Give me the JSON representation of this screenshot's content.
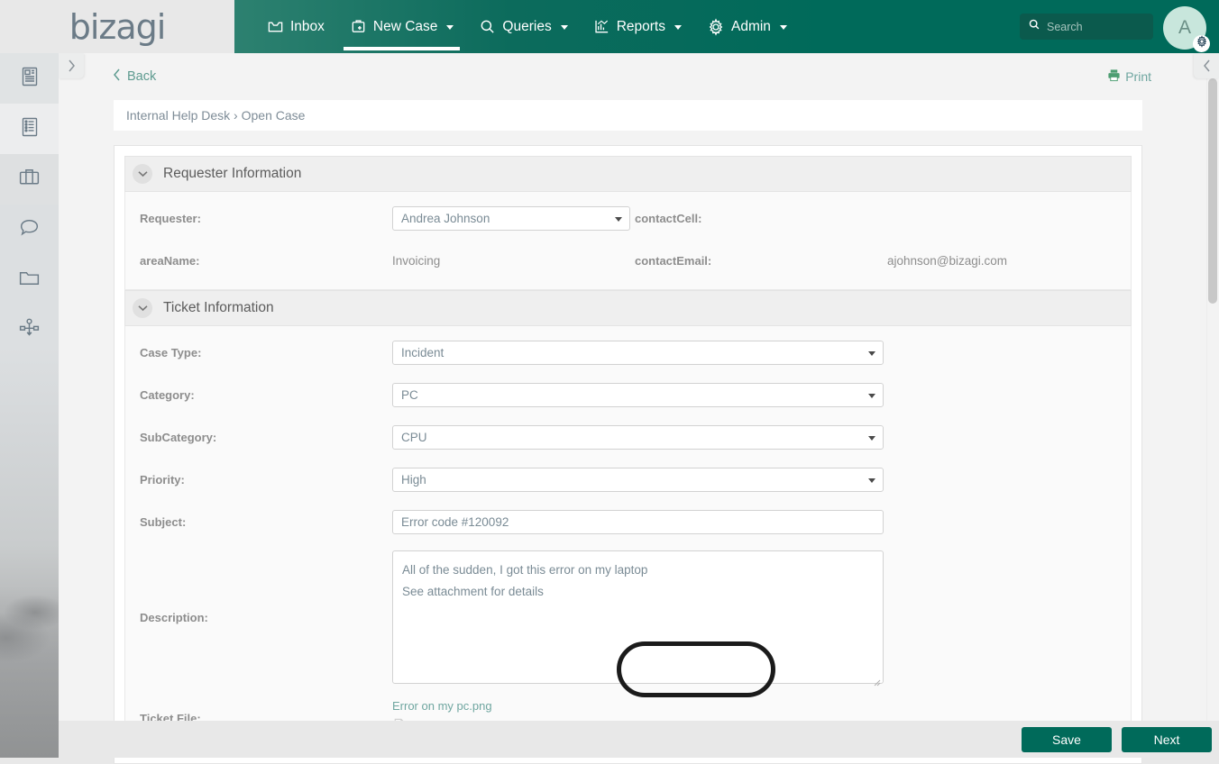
{
  "brand": {
    "logo_text": "bizagi",
    "accent_color": "#006a5a",
    "link_color": "#6fa6a0"
  },
  "header": {
    "nav": [
      {
        "label": "Inbox",
        "icon": "inbox-icon",
        "has_caret": false,
        "active": false
      },
      {
        "label": "New Case",
        "icon": "new-case-icon",
        "has_caret": true,
        "active": true
      },
      {
        "label": "Queries",
        "icon": "search-icon",
        "has_caret": true,
        "active": false
      },
      {
        "label": "Reports",
        "icon": "chart-icon",
        "has_caret": true,
        "active": false
      },
      {
        "label": "Admin",
        "icon": "gear-icon",
        "has_caret": true,
        "active": false
      }
    ],
    "search_placeholder": "Search",
    "avatar_initial": "A"
  },
  "sidebar": {
    "items": [
      {
        "icon": "news-article-icon"
      },
      {
        "icon": "list-document-icon"
      },
      {
        "icon": "briefcase-icon"
      },
      {
        "icon": "chat-bubble-icon"
      },
      {
        "icon": "folder-icon"
      },
      {
        "icon": "org-chart-icon"
      }
    ]
  },
  "toolbar": {
    "back_label": "Back",
    "print_label": "Print",
    "breadcrumb": "Internal Help Desk › Open Case"
  },
  "form": {
    "sections": [
      {
        "title": "Requester Information",
        "rows": [
          {
            "left_label": "Requester:",
            "left_value": "Andrea Johnson",
            "left_type": "dropdown",
            "right_label": "contactCell:",
            "right_value": "",
            "right_type": "static"
          },
          {
            "left_label": "areaName:",
            "left_value": "Invoicing",
            "left_type": "static",
            "right_label": "contactEmail:",
            "right_value": "ajohnson@bizagi.com",
            "right_type": "static"
          }
        ]
      },
      {
        "title": "Ticket Information",
        "fields": [
          {
            "label": "Case Type:",
            "value": "Incident",
            "type": "dropdown"
          },
          {
            "label": "Category:",
            "value": "PC",
            "type": "dropdown"
          },
          {
            "label": "SubCategory:",
            "value": "CPU",
            "type": "dropdown"
          },
          {
            "label": "Priority:",
            "value": "High",
            "type": "dropdown"
          },
          {
            "label": "Subject:",
            "value": "Error code #120092",
            "type": "text"
          }
        ],
        "description": {
          "label": "Description:",
          "line1": "All of the sudden, I got this error on my laptop",
          "line2": "See attachment for details"
        },
        "ticket_file": {
          "label": "Ticket File:",
          "file_name": "Error on my pc.png",
          "icon": "file-upload-icon"
        }
      }
    ]
  },
  "footer": {
    "save_label": "Save",
    "next_label": "Next"
  }
}
